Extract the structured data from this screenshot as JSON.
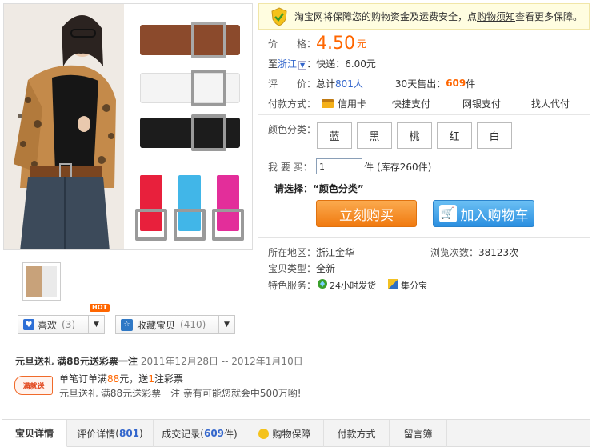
{
  "guarantee": {
    "text_before": "淘宝网将保障您的购物资金及运费安全，点",
    "link": "购物须知",
    "text_after": "查看更多保障。"
  },
  "price": {
    "label": "价　　格：",
    "value": "4.50",
    "unit": "元"
  },
  "shipping": {
    "prefix": "至",
    "location": "浙江",
    "text": "：快递：6.00元"
  },
  "rating": {
    "label": "评　　价：",
    "total_prefix": "总计",
    "count": "801人",
    "sold_prefix": "30天售出：",
    "sold": "609",
    "sold_unit": "件"
  },
  "payment": {
    "label": "付款方式：",
    "options": [
      "信用卡",
      "快捷支付",
      "网银支付",
      "找人代付"
    ]
  },
  "color": {
    "label": "颜色分类：",
    "options": [
      "蓝",
      "黑",
      "桃",
      "红",
      "白"
    ]
  },
  "quantity": {
    "label": "我 要 买：",
    "value": "1",
    "unit": "件",
    "stock": "(库存260件)"
  },
  "select_prompt": "请选择：“颜色分类”",
  "buttons": {
    "buy_now": "立刻购买",
    "add_cart": "加入购物车"
  },
  "info": {
    "region_label": "所在地区：",
    "region": "浙江金华",
    "views_label": "浏览次数：",
    "views": "38123次",
    "type_label": "宝贝类型：",
    "type": "全新",
    "service_label": "特色服务：",
    "service1": "24小时发货",
    "service2": "集分宝"
  },
  "like": {
    "label": "喜欢",
    "count": "(3)",
    "hot": "HOT"
  },
  "fav": {
    "label": "收藏宝贝",
    "count": "(410)"
  },
  "promo": {
    "title": "元旦送礼 满88元送彩票一注",
    "dates": "2011年12月28日 -- 2012年1月10日",
    "line1_a": "单笔订单满",
    "line1_amount": "88",
    "line1_b": "元，送",
    "line1_c": "1",
    "line1_d": "注彩票",
    "line2": "元旦送礼 满88元送彩票一注 亲有可能您就会中500万哟!",
    "badge": "满就送"
  },
  "tabs": [
    {
      "label": "宝贝详情",
      "num": ""
    },
    {
      "label": "评价详情",
      "num": "801"
    },
    {
      "label": "成交记录",
      "num": "609"
    },
    {
      "label": "购物保障",
      "num": ""
    },
    {
      "label": "付款方式",
      "num": ""
    },
    {
      "label": "留言簿",
      "num": ""
    }
  ],
  "colors": {
    "accent_orange": "#f60",
    "link_blue": "#36c",
    "buy_button": "#f98c2a",
    "cart_button": "#3fa6ee"
  }
}
